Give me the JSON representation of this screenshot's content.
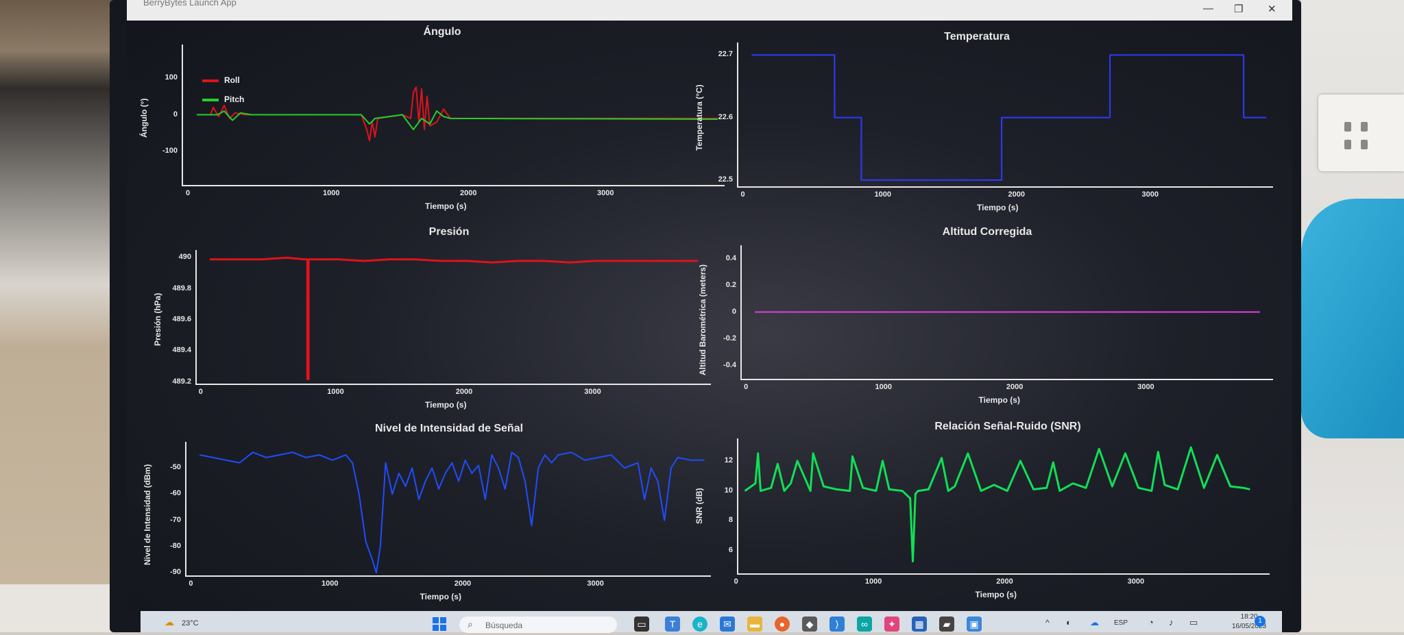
{
  "window": {
    "title": "BerryBytes Launch App"
  },
  "taskbar": {
    "weather": "23°C",
    "search_placeholder": "Búsqueda",
    "language": "ESP",
    "time": "18:20",
    "date": "16/05/2023"
  },
  "colors": {
    "roll": "#e0121b",
    "pitch": "#22d02a",
    "angle_mean": "#d8d000",
    "temperature": "#2b3bff",
    "pressure": "#e0121b",
    "altitude": "#e040e0",
    "signal": "#1f4dff",
    "snr": "#10e055"
  },
  "chart_data": [
    {
      "id": "angulo",
      "type": "line",
      "title": "Ángulo",
      "xlabel": "Tiempo (s)",
      "ylabel": "Ángulo (°)",
      "xlim": [
        -100,
        3850
      ],
      "ylim": [
        -190,
        190
      ],
      "xticks": [
        "0",
        "1000",
        "2000",
        "3000"
      ],
      "xtick_values": [
        0,
        1000,
        2000,
        3000
      ],
      "yticks": [
        "100",
        "0",
        "-100"
      ],
      "ytick_values": [
        100,
        0,
        -100
      ],
      "legend": "top-left",
      "series": [
        {
          "name": "Roll",
          "color": "#e0121b",
          "x": [
            0,
            100,
            120,
            160,
            200,
            240,
            280,
            350,
            1000,
            1200,
            1240,
            1260,
            1280,
            1300,
            1320,
            1500,
            1560,
            1580,
            1600,
            1620,
            1640,
            1660,
            1680,
            1700,
            1750,
            1800,
            1850,
            3800
          ],
          "y": [
            0,
            0,
            20,
            -5,
            25,
            -10,
            5,
            0,
            0,
            0,
            -40,
            -70,
            -20,
            -60,
            -10,
            0,
            -10,
            60,
            75,
            -20,
            70,
            -40,
            50,
            -30,
            -20,
            15,
            -10,
            -10
          ]
        },
        {
          "name": "Pitch",
          "color": "#22d02a",
          "x": [
            0,
            150,
            200,
            260,
            320,
            400,
            1200,
            1260,
            1300,
            1500,
            1580,
            1640,
            1700,
            1750,
            1800,
            1850,
            3800
          ],
          "y": [
            0,
            0,
            10,
            -15,
            5,
            0,
            0,
            -25,
            -10,
            0,
            -40,
            -10,
            -25,
            10,
            -5,
            -10,
            -12
          ]
        }
      ]
    },
    {
      "id": "temperatura",
      "type": "line",
      "title": "Temperatura",
      "xlabel": "Tiempo (s)",
      "ylabel": "Temperatura (°C)",
      "xlim": [
        -100,
        3900
      ],
      "ylim": [
        22.49,
        22.72
      ],
      "xticks": [
        "0",
        "1000",
        "2000",
        "3000"
      ],
      "xtick_values": [
        0,
        1000,
        2000,
        3000
      ],
      "yticks": [
        "22.7",
        "22.6",
        "22.5"
      ],
      "ytick_values": [
        22.7,
        22.6,
        22.5
      ],
      "series": [
        {
          "name": "",
          "color": "#2b3bff",
          "x": [
            0,
            620,
            620,
            820,
            820,
            1870,
            1870,
            2680,
            2680,
            3680,
            3680,
            3850
          ],
          "y": [
            22.7,
            22.7,
            22.6,
            22.6,
            22.5,
            22.5,
            22.6,
            22.6,
            22.7,
            22.7,
            22.6,
            22.6
          ]
        }
      ]
    },
    {
      "id": "presion",
      "type": "line",
      "title": "Presión",
      "xlabel": "Tiempo (s)",
      "ylabel": "Presión (hPa)",
      "xlim": [
        -100,
        3900
      ],
      "ylim": [
        489.19,
        490.05
      ],
      "xticks": [
        "0",
        "1000",
        "2000",
        "3000"
      ],
      "xtick_values": [
        0,
        1000,
        2000,
        3000
      ],
      "yticks": [
        "490",
        "489.8",
        "489.6",
        "489.4",
        "489.2"
      ],
      "ytick_values": [
        490,
        489.8,
        489.6,
        489.4,
        489.2
      ],
      "series": [
        {
          "name": "",
          "color": "#e0121b",
          "x": [
            0,
            200,
            400,
            600,
            740,
            760,
            760,
            770,
            770,
            1000,
            1200,
            1400,
            1600,
            1800,
            2000,
            2200,
            2400,
            2600,
            2800,
            3000,
            3200,
            3400,
            3600,
            3800
          ],
          "y": [
            489.99,
            489.99,
            489.99,
            490.0,
            489.99,
            489.99,
            489.22,
            489.22,
            489.99,
            489.99,
            489.98,
            489.99,
            489.99,
            489.98,
            489.98,
            489.97,
            489.98,
            489.98,
            489.97,
            489.98,
            489.98,
            489.98,
            489.98,
            489.98
          ]
        }
      ]
    },
    {
      "id": "altitud",
      "type": "line",
      "title": "Altitud Corregida",
      "xlabel": "Tiempo (s)",
      "ylabel": "Altitud Barométrica (meters)",
      "xlim": [
        -100,
        3950
      ],
      "ylim": [
        -0.5,
        0.5
      ],
      "xticks": [
        "0",
        "1000",
        "2000",
        "3000"
      ],
      "xtick_values": [
        0,
        1000,
        2000,
        3000
      ],
      "yticks": [
        "0.4",
        "0.2",
        "0",
        "-0.2",
        "-0.4"
      ],
      "ytick_values": [
        0.4,
        0.2,
        0,
        -0.2,
        -0.4
      ],
      "series": [
        {
          "name": "",
          "color": "#e040e0",
          "x": [
            0,
            3850
          ],
          "y": [
            0,
            0
          ]
        }
      ]
    },
    {
      "id": "senal",
      "type": "line",
      "title": "Nivel de Intensidad de Señal",
      "xlabel": "Tiempo (s)",
      "ylabel": "Nivel de Intensidad (dBm)",
      "xlim": [
        -100,
        3850
      ],
      "ylim": [
        -91,
        -40
      ],
      "xticks": [
        "0",
        "1000",
        "2000",
        "3000"
      ],
      "xtick_values": [
        0,
        1000,
        2000,
        3000
      ],
      "yticks": [
        "-50",
        "-60",
        "-70",
        "-80",
        "-90"
      ],
      "ytick_values": [
        -50,
        -60,
        -70,
        -80,
        -90
      ],
      "series": [
        {
          "name": "",
          "color": "#1f4dff",
          "x": [
            0,
            100,
            200,
            300,
            400,
            500,
            600,
            700,
            800,
            900,
            1000,
            1100,
            1150,
            1200,
            1250,
            1300,
            1330,
            1360,
            1400,
            1450,
            1500,
            1550,
            1600,
            1650,
            1700,
            1750,
            1800,
            1850,
            1900,
            1950,
            2000,
            2050,
            2100,
            2150,
            2200,
            2250,
            2300,
            2350,
            2400,
            2450,
            2500,
            2550,
            2600,
            2650,
            2700,
            2800,
            2900,
            3000,
            3100,
            3200,
            3300,
            3350,
            3400,
            3450,
            3500,
            3550,
            3600,
            3700,
            3800
          ],
          "y": [
            -45,
            -46,
            -47,
            -48,
            -44,
            -46,
            -45,
            -44,
            -46,
            -45,
            -47,
            -45,
            -48,
            -60,
            -78,
            -85,
            -90,
            -80,
            -48,
            -60,
            -52,
            -57,
            -50,
            -62,
            -55,
            -50,
            -58,
            -52,
            -48,
            -55,
            -47,
            -52,
            -49,
            -62,
            -45,
            -50,
            -58,
            -44,
            -46,
            -55,
            -72,
            -50,
            -45,
            -48,
            -45,
            -44,
            -47,
            -46,
            -45,
            -50,
            -48,
            -62,
            -50,
            -55,
            -70,
            -50,
            -46,
            -47,
            -47
          ]
        }
      ]
    },
    {
      "id": "snr",
      "type": "line",
      "title": "Relación Señal-Ruido (SNR)",
      "xlabel": "Tiempo (s)",
      "ylabel": "SNR (dB)",
      "xlim": [
        -50,
        4000
      ],
      "ylim": [
        4.5,
        13.5
      ],
      "xticks": [
        "0",
        "1000",
        "2000",
        "3000"
      ],
      "xtick_values": [
        0,
        1000,
        2000,
        3000
      ],
      "yticks": [
        "12",
        "10",
        "8",
        "6"
      ],
      "ytick_values": [
        12,
        10,
        8,
        6
      ],
      "series": [
        {
          "name": "",
          "color": "#10e055",
          "x": [
            0,
            80,
            100,
            120,
            200,
            250,
            300,
            350,
            400,
            500,
            520,
            600,
            700,
            800,
            820,
            900,
            1000,
            1050,
            1100,
            1200,
            1260,
            1280,
            1300,
            1320,
            1400,
            1500,
            1550,
            1600,
            1700,
            1800,
            1900,
            2000,
            2100,
            2200,
            2300,
            2350,
            2400,
            2500,
            2600,
            2700,
            2800,
            2900,
            3000,
            3100,
            3150,
            3200,
            3300,
            3400,
            3500,
            3600,
            3700,
            3800,
            3850
          ],
          "y": [
            10,
            10.5,
            12.5,
            10,
            10.2,
            11.8,
            10,
            10.5,
            12,
            10,
            12.5,
            10.3,
            10.1,
            10,
            12.3,
            10.2,
            10,
            12,
            10.1,
            10,
            9.5,
            5.3,
            9.8,
            10,
            10.1,
            12.2,
            10,
            10.3,
            12.5,
            10,
            10.4,
            10,
            12,
            10.1,
            10.2,
            11.9,
            10,
            10.5,
            10.2,
            12.8,
            10.3,
            12.5,
            10.2,
            10,
            12.6,
            10.4,
            10.1,
            12.9,
            10.2,
            12.4,
            10.3,
            10.2,
            10.1
          ]
        }
      ]
    }
  ]
}
